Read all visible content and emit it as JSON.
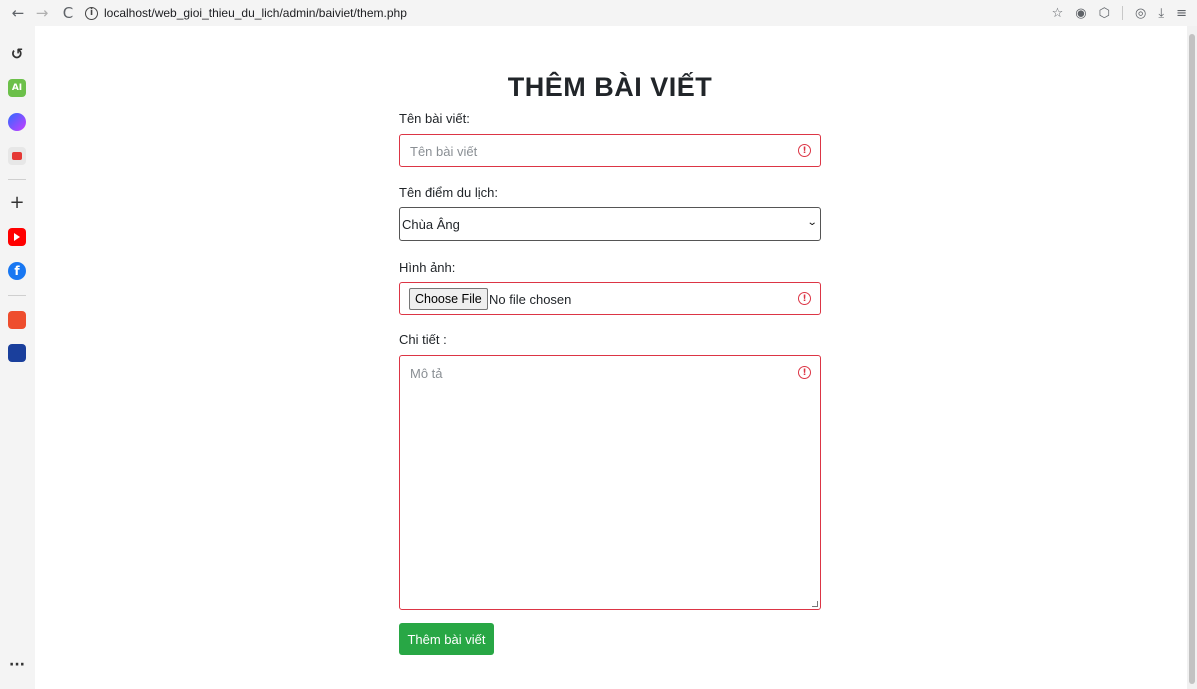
{
  "browser": {
    "url": "localhost/web_gioi_thieu_du_lich/admin/baiviet/them.php",
    "back_icon": "←",
    "forward_icon": "→",
    "reload_icon": "C",
    "info_icon": "i",
    "star_icon": "☆",
    "shield_icon": "◉",
    "extensions_icon": "⬡",
    "profile_icon": "◎",
    "download_icon": "⤓",
    "menu_icon": "≡"
  },
  "sidebar": {
    "history_icon": "↺",
    "ai_label": "AI",
    "plus_icon": "+",
    "more_icon": "···"
  },
  "form": {
    "title": "THÊM BÀI VIẾT",
    "name_label": "Tên bài viết:",
    "name_placeholder": "Tên bài viết",
    "place_label": "Tên điểm du lịch:",
    "place_selected": "Chùa Âng",
    "image_label": "Hình ảnh:",
    "choose_file_label": "Choose File",
    "no_file_label": "No file chosen",
    "detail_label": "Chi tiết :",
    "detail_placeholder": "Mô tả",
    "submit_label": "Thêm bài viết",
    "warn_icon": "!"
  },
  "colors": {
    "invalid_border": "#dc3545",
    "submit_bg": "#28a745"
  }
}
